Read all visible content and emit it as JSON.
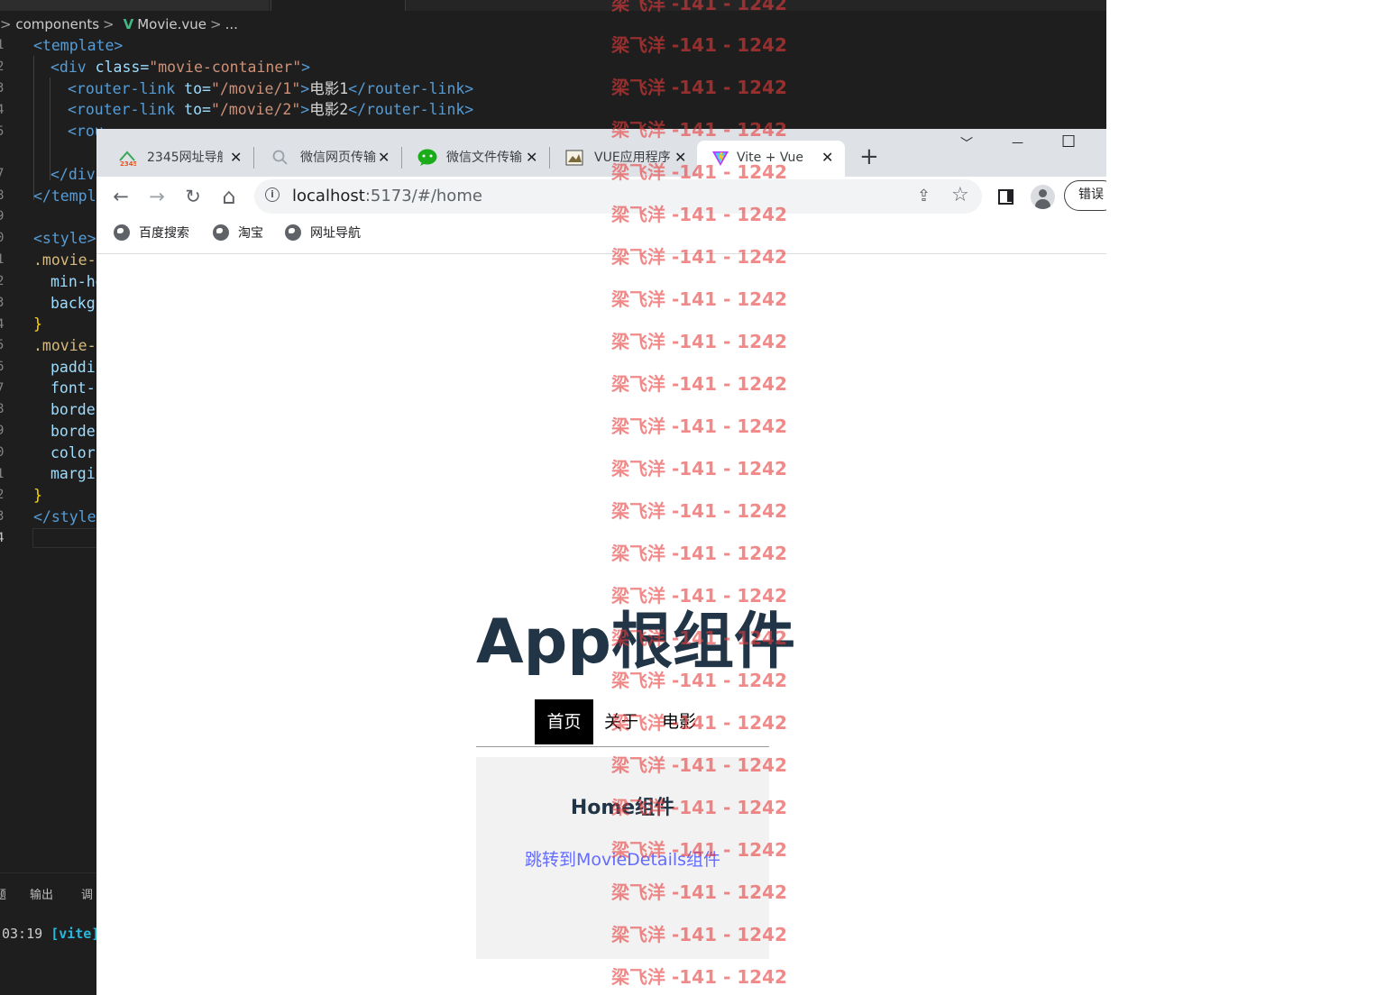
{
  "editor": {
    "breadcrumb": {
      "folder": "components",
      "vue_badge": "V",
      "file": "Movie.vue",
      "more": "..."
    },
    "line_numbers": [
      "1",
      "2",
      "3",
      "4",
      "5",
      "6",
      "7",
      "8",
      "9",
      "0",
      "1",
      "2",
      "3",
      "4",
      "5",
      "6",
      "7",
      "8",
      "9",
      "0",
      "1",
      "2",
      "3",
      "4"
    ],
    "code": {
      "l1": "<template>",
      "l2_tag": "<div ",
      "l2_attr": "class=",
      "l2_str": "\"movie-container\"",
      "l2_end": ">",
      "l3_tag": "<router-link ",
      "l3_attr": "to=",
      "l3_str": "\"/movie/1\"",
      "l3_gt": ">",
      "l3_text": "电影1",
      "l3_close": "</router-link>",
      "l4_tag": "<router-link ",
      "l4_attr": "to=",
      "l4_str": "\"/movie/2\"",
      "l4_gt": ">",
      "l4_text": "电影2",
      "l4_close": "</router-link>",
      "l5": "<rou",
      "l6": "<rou",
      "l7": "</div",
      "l8": "</templa",
      "l10": "<style>",
      "l11": ".movie-c",
      "l12": "min-he",
      "l13": "backgr",
      "l14": "}",
      "l15": ".movie-c",
      "l16": "paddir",
      "l17": "font-s",
      "l18": "border",
      "l19": "border",
      "l20": "color",
      "l21": "margir",
      "l22": "}",
      "l23": "</style"
    },
    "panel": {
      "tab1": "题",
      "tab2": "输出",
      "tab3": "调",
      "terminal_time": "03:19",
      "terminal_tag": "[vite]"
    }
  },
  "browser": {
    "tabs": [
      {
        "label": "2345网址导航",
        "close": "✕"
      },
      {
        "label": "微信网页传输",
        "close": "✕"
      },
      {
        "label": "微信文件传输",
        "close": "✕"
      },
      {
        "label": "VUE应用程序",
        "close": "✕"
      },
      {
        "label": "Vite + Vue",
        "close": "✕"
      }
    ],
    "new_tab": "+",
    "window_controls": {
      "dropdown": "﹀",
      "minimize": "—",
      "maximize": "☐"
    },
    "toolbar": {
      "back": "←",
      "forward": "→",
      "reload": "↻",
      "home": "⌂",
      "info_icon": "i",
      "share": "⇪",
      "star": "☆"
    },
    "address": {
      "host": "localhost",
      "path": ":5173/#/home"
    },
    "error_button": "错误",
    "bookmarks": [
      "百度搜索",
      "淘宝",
      "网址导航"
    ]
  },
  "page": {
    "title": "App根组件",
    "nav": [
      {
        "label": "首页",
        "active": true
      },
      {
        "label": "关于",
        "active": false
      },
      {
        "label": "电影",
        "active": false
      }
    ],
    "home": {
      "heading": "Home组件",
      "link": "跳转到MovieDetails组件"
    }
  },
  "watermark": {
    "text": "梁飞洋 -141 - 1242",
    "color": "#e93a3a"
  },
  "colors": {
    "editor_bg": "#1e1e1e",
    "titlebar": "#dee1e6",
    "link": "#646cff",
    "heading": "#213547"
  }
}
